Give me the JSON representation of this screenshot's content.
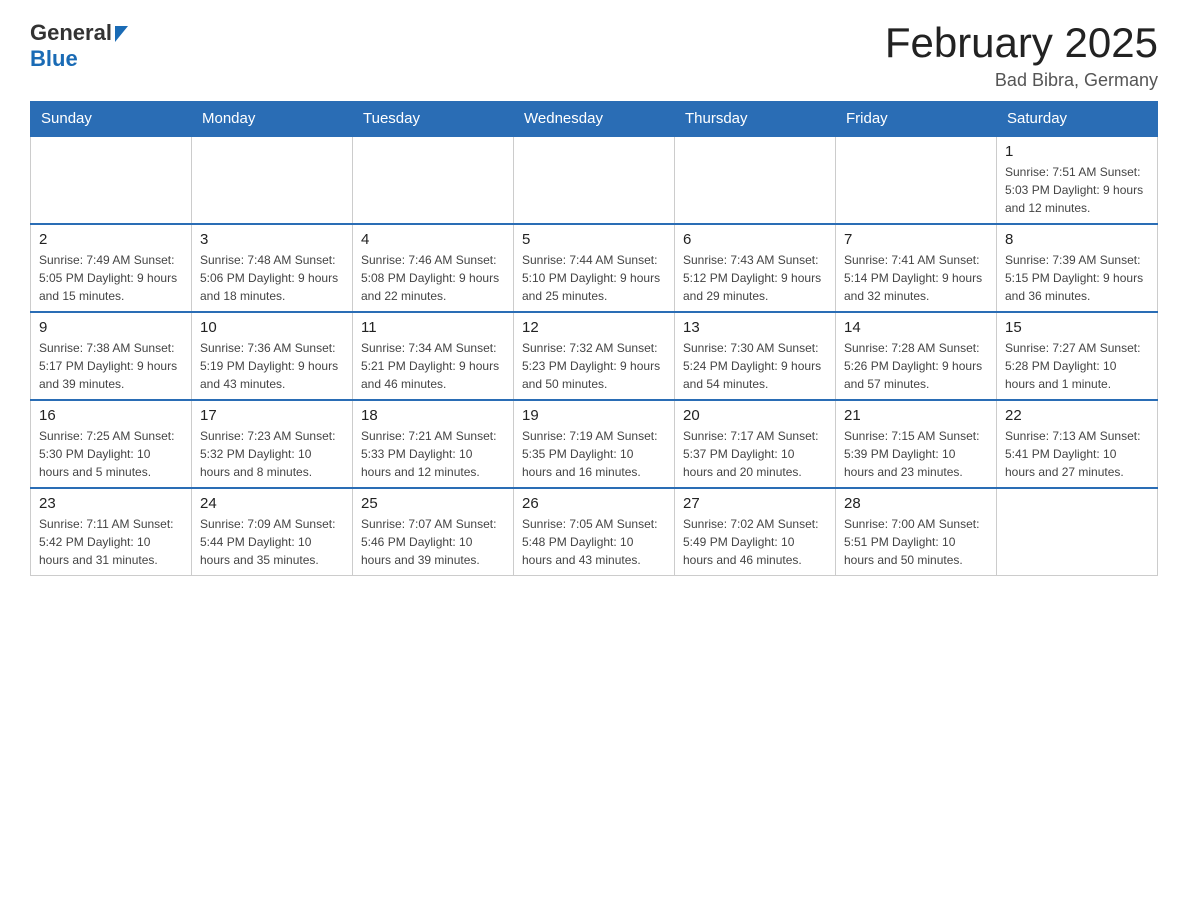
{
  "header": {
    "logo_general": "General",
    "logo_blue": "Blue",
    "month_title": "February 2025",
    "location": "Bad Bibra, Germany"
  },
  "weekdays": [
    "Sunday",
    "Monday",
    "Tuesday",
    "Wednesday",
    "Thursday",
    "Friday",
    "Saturday"
  ],
  "weeks": [
    [
      {
        "day": "",
        "info": ""
      },
      {
        "day": "",
        "info": ""
      },
      {
        "day": "",
        "info": ""
      },
      {
        "day": "",
        "info": ""
      },
      {
        "day": "",
        "info": ""
      },
      {
        "day": "",
        "info": ""
      },
      {
        "day": "1",
        "info": "Sunrise: 7:51 AM\nSunset: 5:03 PM\nDaylight: 9 hours and 12 minutes."
      }
    ],
    [
      {
        "day": "2",
        "info": "Sunrise: 7:49 AM\nSunset: 5:05 PM\nDaylight: 9 hours and 15 minutes."
      },
      {
        "day": "3",
        "info": "Sunrise: 7:48 AM\nSunset: 5:06 PM\nDaylight: 9 hours and 18 minutes."
      },
      {
        "day": "4",
        "info": "Sunrise: 7:46 AM\nSunset: 5:08 PM\nDaylight: 9 hours and 22 minutes."
      },
      {
        "day": "5",
        "info": "Sunrise: 7:44 AM\nSunset: 5:10 PM\nDaylight: 9 hours and 25 minutes."
      },
      {
        "day": "6",
        "info": "Sunrise: 7:43 AM\nSunset: 5:12 PM\nDaylight: 9 hours and 29 minutes."
      },
      {
        "day": "7",
        "info": "Sunrise: 7:41 AM\nSunset: 5:14 PM\nDaylight: 9 hours and 32 minutes."
      },
      {
        "day": "8",
        "info": "Sunrise: 7:39 AM\nSunset: 5:15 PM\nDaylight: 9 hours and 36 minutes."
      }
    ],
    [
      {
        "day": "9",
        "info": "Sunrise: 7:38 AM\nSunset: 5:17 PM\nDaylight: 9 hours and 39 minutes."
      },
      {
        "day": "10",
        "info": "Sunrise: 7:36 AM\nSunset: 5:19 PM\nDaylight: 9 hours and 43 minutes."
      },
      {
        "day": "11",
        "info": "Sunrise: 7:34 AM\nSunset: 5:21 PM\nDaylight: 9 hours and 46 minutes."
      },
      {
        "day": "12",
        "info": "Sunrise: 7:32 AM\nSunset: 5:23 PM\nDaylight: 9 hours and 50 minutes."
      },
      {
        "day": "13",
        "info": "Sunrise: 7:30 AM\nSunset: 5:24 PM\nDaylight: 9 hours and 54 minutes."
      },
      {
        "day": "14",
        "info": "Sunrise: 7:28 AM\nSunset: 5:26 PM\nDaylight: 9 hours and 57 minutes."
      },
      {
        "day": "15",
        "info": "Sunrise: 7:27 AM\nSunset: 5:28 PM\nDaylight: 10 hours and 1 minute."
      }
    ],
    [
      {
        "day": "16",
        "info": "Sunrise: 7:25 AM\nSunset: 5:30 PM\nDaylight: 10 hours and 5 minutes."
      },
      {
        "day": "17",
        "info": "Sunrise: 7:23 AM\nSunset: 5:32 PM\nDaylight: 10 hours and 8 minutes."
      },
      {
        "day": "18",
        "info": "Sunrise: 7:21 AM\nSunset: 5:33 PM\nDaylight: 10 hours and 12 minutes."
      },
      {
        "day": "19",
        "info": "Sunrise: 7:19 AM\nSunset: 5:35 PM\nDaylight: 10 hours and 16 minutes."
      },
      {
        "day": "20",
        "info": "Sunrise: 7:17 AM\nSunset: 5:37 PM\nDaylight: 10 hours and 20 minutes."
      },
      {
        "day": "21",
        "info": "Sunrise: 7:15 AM\nSunset: 5:39 PM\nDaylight: 10 hours and 23 minutes."
      },
      {
        "day": "22",
        "info": "Sunrise: 7:13 AM\nSunset: 5:41 PM\nDaylight: 10 hours and 27 minutes."
      }
    ],
    [
      {
        "day": "23",
        "info": "Sunrise: 7:11 AM\nSunset: 5:42 PM\nDaylight: 10 hours and 31 minutes."
      },
      {
        "day": "24",
        "info": "Sunrise: 7:09 AM\nSunset: 5:44 PM\nDaylight: 10 hours and 35 minutes."
      },
      {
        "day": "25",
        "info": "Sunrise: 7:07 AM\nSunset: 5:46 PM\nDaylight: 10 hours and 39 minutes."
      },
      {
        "day": "26",
        "info": "Sunrise: 7:05 AM\nSunset: 5:48 PM\nDaylight: 10 hours and 43 minutes."
      },
      {
        "day": "27",
        "info": "Sunrise: 7:02 AM\nSunset: 5:49 PM\nDaylight: 10 hours and 46 minutes."
      },
      {
        "day": "28",
        "info": "Sunrise: 7:00 AM\nSunset: 5:51 PM\nDaylight: 10 hours and 50 minutes."
      },
      {
        "day": "",
        "info": ""
      }
    ]
  ]
}
